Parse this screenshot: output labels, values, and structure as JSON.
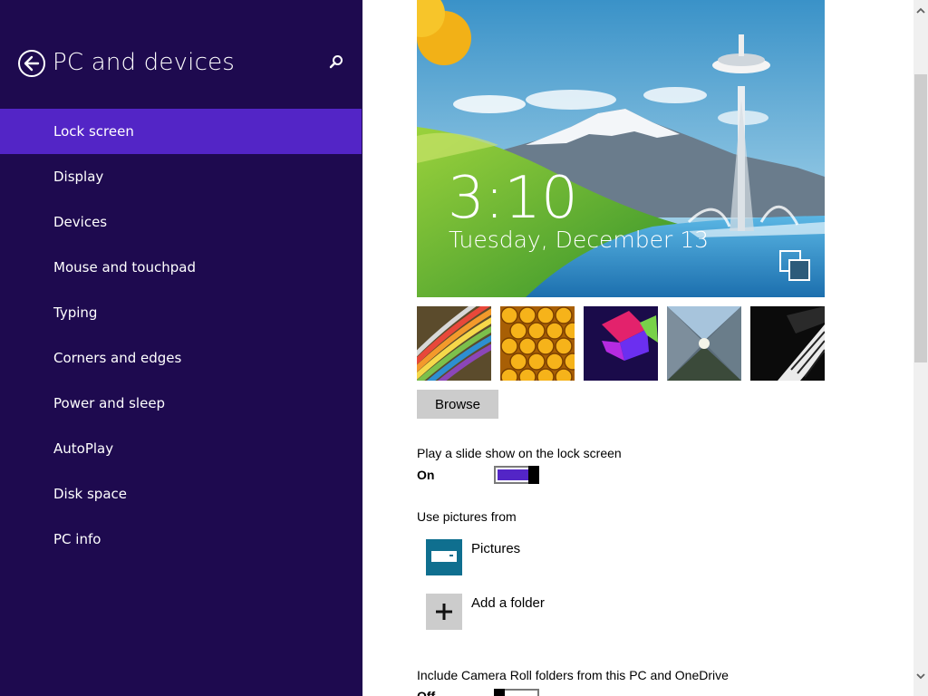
{
  "sidebar": {
    "title": "PC and devices",
    "back_icon": "back-arrow-icon",
    "search_icon": "search-icon",
    "items": [
      {
        "label": "Lock screen",
        "active": true
      },
      {
        "label": "Display"
      },
      {
        "label": "Devices"
      },
      {
        "label": "Mouse and touchpad"
      },
      {
        "label": "Typing"
      },
      {
        "label": "Corners and edges"
      },
      {
        "label": "Power and sleep"
      },
      {
        "label": "AutoPlay"
      },
      {
        "label": "Disk space"
      },
      {
        "label": "PC info"
      }
    ]
  },
  "lockscreen_preview": {
    "time": "3:10",
    "date": "Tuesday, December 13"
  },
  "thumbnails": [
    "rainbow-curves",
    "honeycomb",
    "purple-tiles",
    "tunnel",
    "piano-keys"
  ],
  "browse_label": "Browse",
  "slideshow": {
    "label": "Play a slide show on the lock screen",
    "state": "On"
  },
  "pictures_from": {
    "label": "Use pictures from",
    "folders": [
      {
        "label": "Pictures",
        "icon": "pictures-folder-icon"
      },
      {
        "label": "Add a folder",
        "icon": "plus-icon"
      }
    ]
  },
  "camera_roll": {
    "label": "Include Camera Roll folders from this PC and OneDrive",
    "state": "Off"
  },
  "colors": {
    "sidebar_bg": "#1e0a4f",
    "accent": "#5325c6",
    "folder_tile": "#0f6f8f"
  }
}
